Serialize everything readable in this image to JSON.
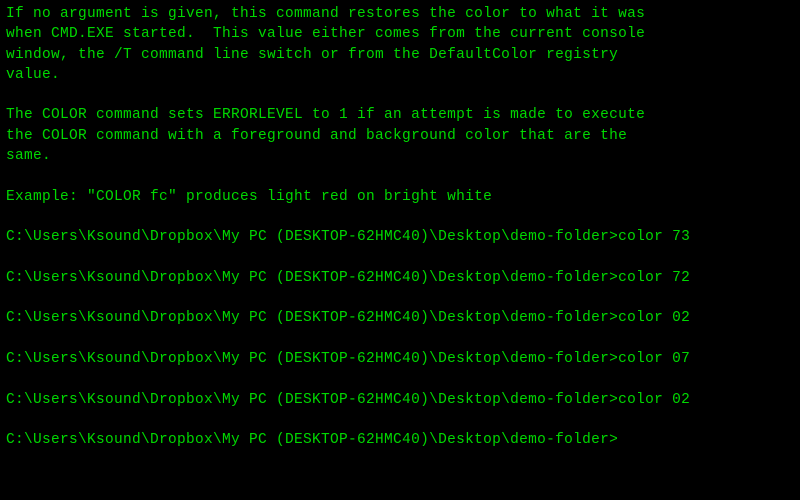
{
  "help": {
    "para1": "If no argument is given, this command restores the color to what it was\nwhen CMD.EXE started.  This value either comes from the current console\nwindow, the /T command line switch or from the DefaultColor registry\nvalue.",
    "para2": "The COLOR command sets ERRORLEVEL to 1 if an attempt is made to execute\nthe COLOR command with a foreground and background color that are the\nsame.",
    "example": "Example: \"COLOR fc\" produces light red on bright white"
  },
  "prompt": "C:\\Users\\Ksound\\Dropbox\\My PC (DESKTOP-62HMC40)\\Desktop\\demo-folder>",
  "commands": [
    "color 73",
    "color 72",
    "color 02",
    "color 07",
    "color 02"
  ]
}
